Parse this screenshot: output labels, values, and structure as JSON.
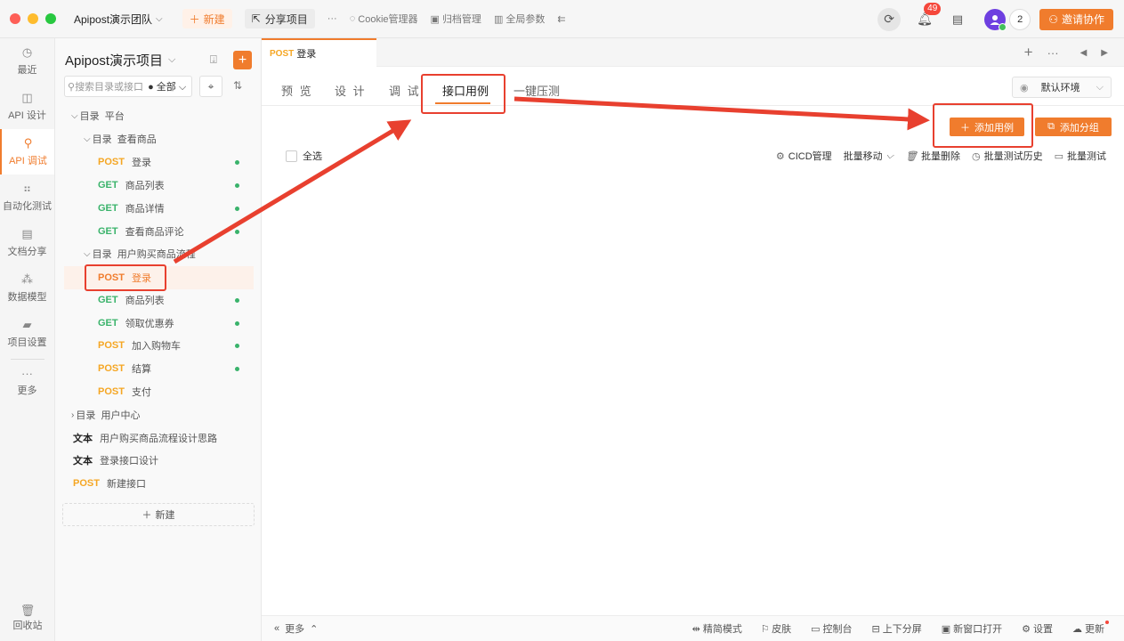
{
  "titlebar": {
    "team": "Apipost演示团队",
    "new_label": "新建",
    "share_label": "分享项目",
    "more": "···",
    "cookie": "Cookie管理器",
    "archive": "归档管理",
    "global_params": "全局参数",
    "notif_count": "49",
    "member_count": "2",
    "invite_label": "邀请协作"
  },
  "rail": {
    "items": [
      {
        "label": "最近",
        "icon": "clock-icon"
      },
      {
        "label": "API 设计",
        "icon": "design-icon"
      },
      {
        "label": "API 调试",
        "icon": "debug-icon"
      },
      {
        "label": "自动化测试",
        "icon": "flow-icon"
      },
      {
        "label": "文档分享",
        "icon": "doc-share-icon"
      },
      {
        "label": "数据模型",
        "icon": "model-icon"
      },
      {
        "label": "项目设置",
        "icon": "settings-folder-icon"
      },
      {
        "label": "更多",
        "icon": "more-icon"
      }
    ],
    "recycle": "回收站"
  },
  "tree": {
    "project": "Apipost演示项目",
    "search_placeholder": "搜索目录或接口",
    "filter_all": "全部",
    "nodes": [
      {
        "kind": "dir",
        "prefix": "目录",
        "name": "平台"
      },
      {
        "kind": "dir",
        "prefix": "目录",
        "name": "查看商品"
      },
      {
        "kind": "api",
        "method": "POST",
        "name": "登录"
      },
      {
        "kind": "api",
        "method": "GET",
        "name": "商品列表"
      },
      {
        "kind": "api",
        "method": "GET",
        "name": "商品详情"
      },
      {
        "kind": "api",
        "method": "GET",
        "name": "查看商品评论"
      },
      {
        "kind": "dir",
        "prefix": "目录",
        "name": "用户购买商品流程"
      },
      {
        "kind": "api",
        "method": "POST",
        "name": "登录"
      },
      {
        "kind": "api",
        "method": "GET",
        "name": "商品列表"
      },
      {
        "kind": "api",
        "method": "GET",
        "name": "领取优惠券"
      },
      {
        "kind": "api",
        "method": "POST",
        "name": "加入购物车"
      },
      {
        "kind": "api",
        "method": "POST",
        "name": "结算"
      },
      {
        "kind": "api",
        "method": "POST",
        "name": "支付"
      },
      {
        "kind": "dir",
        "prefix": "目录",
        "name": "用户中心"
      },
      {
        "kind": "doc",
        "prefix": "文本",
        "name": "用户购买商品流程设计思路"
      },
      {
        "kind": "doc",
        "prefix": "文本",
        "name": "登录接口设计"
      },
      {
        "kind": "api",
        "method": "POST",
        "name": "新建接口"
      }
    ],
    "new_label": "新建"
  },
  "main": {
    "tab": {
      "method": "POST",
      "name": "登录"
    },
    "subtabs": [
      "预 览",
      "设 计",
      "调 试",
      "接口用例",
      "一键压测"
    ],
    "env": "默认环境",
    "add_case": "添加用例",
    "add_group": "添加分组",
    "select_all": "全选",
    "actions": [
      "CICD管理",
      "批量移动",
      "批量删除",
      "批量测试历史",
      "批量测试"
    ],
    "statusbar": {
      "more": "更多",
      "items": [
        "精简模式",
        "皮肤",
        "控制台",
        "上下分屏",
        "新窗口打开",
        "设置",
        "更新"
      ]
    }
  },
  "colors": {
    "accent": "#f07c2d",
    "post": "#f5a623",
    "get": "#3ab36b",
    "annotation": "#e8402f"
  }
}
